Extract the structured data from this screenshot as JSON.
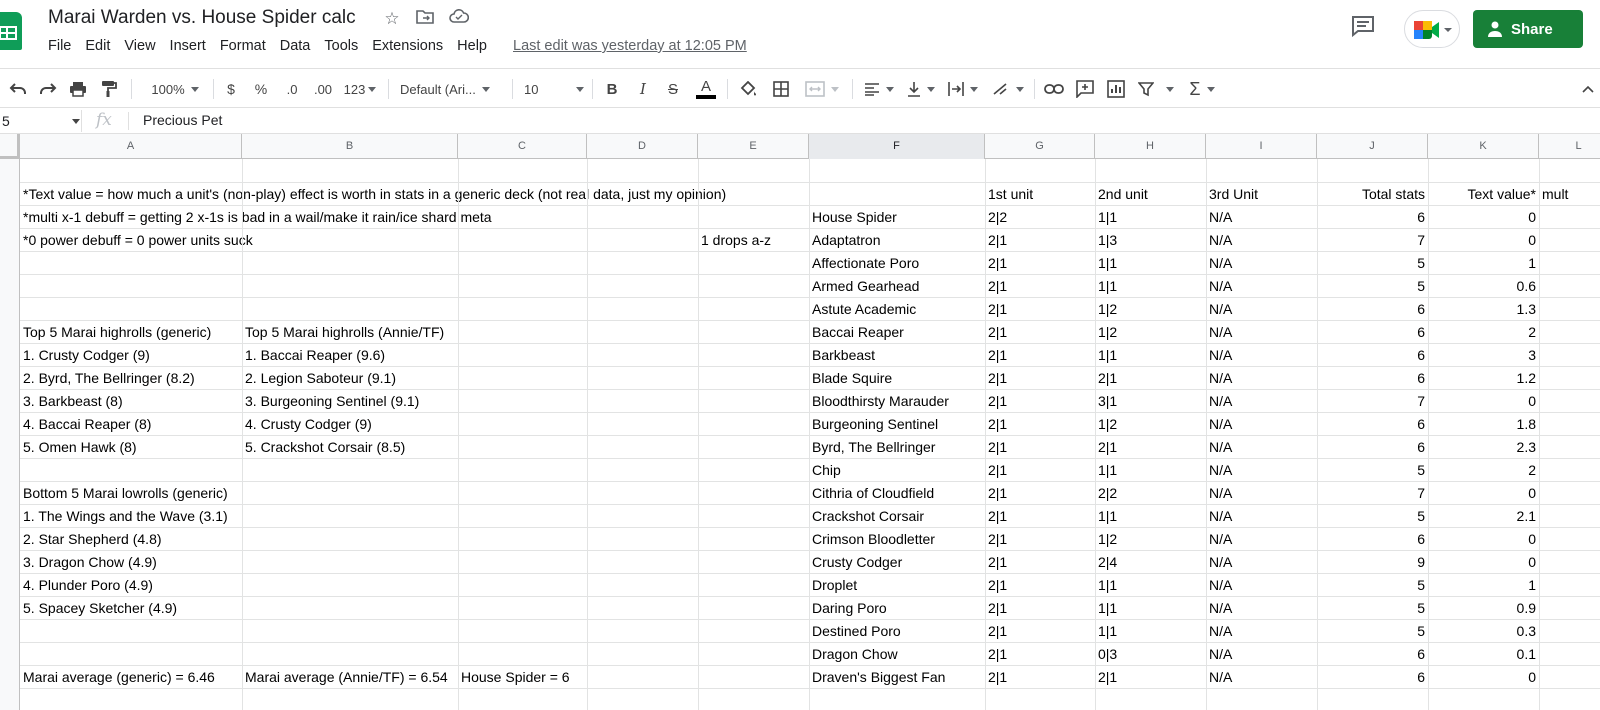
{
  "doc": {
    "title": "Marai Warden vs. House Spider calc",
    "last_edit": "Last edit was yesterday at 12:05 PM",
    "share_label": "Share"
  },
  "menu": [
    "File",
    "Edit",
    "View",
    "Insert",
    "Format",
    "Data",
    "Tools",
    "Extensions",
    "Help"
  ],
  "toolbar": {
    "zoom": "100%",
    "currency": "$",
    "percent": "%",
    "decrease_decimal": ".0",
    "increase_decimal": ".00",
    "more_formats": "123",
    "font": "Default (Ari...",
    "font_size": "10",
    "bold": "B",
    "italic": "I",
    "strike": "S",
    "text_color": "A"
  },
  "formula_bar": {
    "cell_ref": "5",
    "fx": "fx",
    "value": "Precious Pet"
  },
  "columns": [
    "A",
    "B",
    "C",
    "D",
    "E",
    "F",
    "G",
    "H",
    "I",
    "J",
    "K",
    "L"
  ],
  "rows": [
    {
      "a": "",
      "b": "",
      "e": "",
      "f": "",
      "g": "",
      "h": "",
      "i": "",
      "j": "",
      "k": "",
      "l": ""
    },
    {
      "a": "*Text value = how much a unit's (non-play) effect is worth in stats in a generic deck (not real data, just my opinion)",
      "b": "",
      "e": "",
      "f": "",
      "g": "1st unit",
      "h": "2nd unit",
      "i": "3rd Unit",
      "j": "Total stats",
      "k": "Text value*",
      "l": "mult"
    },
    {
      "a": "*multi x-1 debuff = getting 2 x-1s is bad in a wail/make it rain/ice shard meta",
      "b": "",
      "e": "",
      "f": "House Spider",
      "g": "2|2",
      "h": "1|1",
      "i": "N/A",
      "j": "6",
      "k": "0",
      "l": ""
    },
    {
      "a": "*0 power debuff = 0 power units suck",
      "b": "",
      "e": "1 drops a-z",
      "f": "Adaptatron",
      "g": "2|1",
      "h": "1|3",
      "i": "N/A",
      "j": "7",
      "k": "0",
      "l": ""
    },
    {
      "a": "",
      "b": "",
      "e": "",
      "f": "Affectionate Poro",
      "g": "2|1",
      "h": "1|1",
      "i": "N/A",
      "j": "5",
      "k": "1",
      "l": ""
    },
    {
      "a": "",
      "b": "",
      "e": "",
      "f": "Armed Gearhead",
      "g": "2|1",
      "h": "1|1",
      "i": "N/A",
      "j": "5",
      "k": "0.6",
      "l": ""
    },
    {
      "a": "",
      "b": "",
      "e": "",
      "f": "Astute Academic",
      "g": "2|1",
      "h": "1|2",
      "i": "N/A",
      "j": "6",
      "k": "1.3",
      "l": ""
    },
    {
      "a": "Top 5 Marai highrolls (generic)",
      "b": "Top 5 Marai highrolls (Annie/TF)",
      "e": "",
      "f": "Baccai Reaper",
      "g": "2|1",
      "h": "1|2",
      "i": "N/A",
      "j": "6",
      "k": "2",
      "l": ""
    },
    {
      "a": "1. Crusty Codger (9)",
      "b": "1. Baccai Reaper (9.6)",
      "e": "",
      "f": "Barkbeast",
      "g": "2|1",
      "h": "1|1",
      "i": "N/A",
      "j": "6",
      "k": "3",
      "l": ""
    },
    {
      "a": "2. Byrd, The Bellringer (8.2)",
      "b": "2. Legion Saboteur (9.1)",
      "e": "",
      "f": "Blade Squire",
      "g": "2|1",
      "h": "2|1",
      "i": "N/A",
      "j": "6",
      "k": "1.2",
      "l": ""
    },
    {
      "a": "3. Barkbeast (8)",
      "b": "3. Burgeoning Sentinel (9.1)",
      "e": "",
      "f": "Bloodthirsty Marauder",
      "g": "2|1",
      "h": "3|1",
      "i": "N/A",
      "j": "7",
      "k": "0",
      "l": ""
    },
    {
      "a": "4. Baccai Reaper (8)",
      "b": "4. Crusty Codger (9)",
      "e": "",
      "f": "Burgeoning Sentinel",
      "g": "2|1",
      "h": "1|2",
      "i": "N/A",
      "j": "6",
      "k": "1.8",
      "l": ""
    },
    {
      "a": "5. Omen Hawk (8)",
      "b": "5. Crackshot Corsair (8.5)",
      "e": "",
      "f": "Byrd, The Bellringer",
      "g": "2|1",
      "h": "2|1",
      "i": "N/A",
      "j": "6",
      "k": "2.3",
      "l": ""
    },
    {
      "a": "",
      "b": "",
      "e": "",
      "f": "Chip",
      "g": "2|1",
      "h": "1|1",
      "i": "N/A",
      "j": "5",
      "k": "2",
      "l": ""
    },
    {
      "a": "Bottom 5 Marai lowrolls (generic)",
      "b": "",
      "e": "",
      "f": "Cithria of Cloudfield",
      "g": "2|1",
      "h": "2|2",
      "i": "N/A",
      "j": "7",
      "k": "0",
      "l": ""
    },
    {
      "a": "1. The Wings and the Wave (3.1)",
      "b": "",
      "e": "",
      "f": "Crackshot Corsair",
      "g": "2|1",
      "h": "1|1",
      "i": "N/A",
      "j": "5",
      "k": "2.1",
      "l": ""
    },
    {
      "a": "2. Star Shepherd (4.8)",
      "b": "",
      "e": "",
      "f": "Crimson Bloodletter",
      "g": "2|1",
      "h": "1|2",
      "i": "N/A",
      "j": "6",
      "k": "0",
      "l": ""
    },
    {
      "a": "3. Dragon Chow (4.9)",
      "b": "",
      "e": "",
      "f": "Crusty Codger",
      "g": "2|1",
      "h": "2|4",
      "i": "N/A",
      "j": "9",
      "k": "0",
      "l": ""
    },
    {
      "a": "4. Plunder Poro (4.9)",
      "b": "",
      "e": "",
      "f": "Droplet",
      "g": "2|1",
      "h": "1|1",
      "i": "N/A",
      "j": "5",
      "k": "1",
      "l": ""
    },
    {
      "a": "5. Spacey Sketcher (4.9)",
      "b": "",
      "e": "",
      "f": "Daring Poro",
      "g": "2|1",
      "h": "1|1",
      "i": "N/A",
      "j": "5",
      "k": "0.9",
      "l": ""
    },
    {
      "a": "",
      "b": "",
      "e": "",
      "f": "Destined Poro",
      "g": "2|1",
      "h": "1|1",
      "i": "N/A",
      "j": "5",
      "k": "0.3",
      "l": ""
    },
    {
      "a": "",
      "b": "",
      "e": "",
      "f": "Dragon Chow",
      "g": "2|1",
      "h": "0|3",
      "i": "N/A",
      "j": "6",
      "k": "0.1",
      "l": ""
    },
    {
      "a": "Marai average (generic) = 6.46",
      "b": "Marai average (Annie/TF) = 6.54",
      "c": "House Spider = 6",
      "e": "",
      "f": "Draven's Biggest Fan",
      "g": "2|1",
      "h": "2|1",
      "i": "N/A",
      "j": "6",
      "k": "0",
      "l": ""
    }
  ],
  "colors": {
    "share_green": "#188038",
    "sheets_green": "#0f9d58",
    "header_bg": "#f8f9fa",
    "selected_col_bg": "#e8eaed"
  }
}
